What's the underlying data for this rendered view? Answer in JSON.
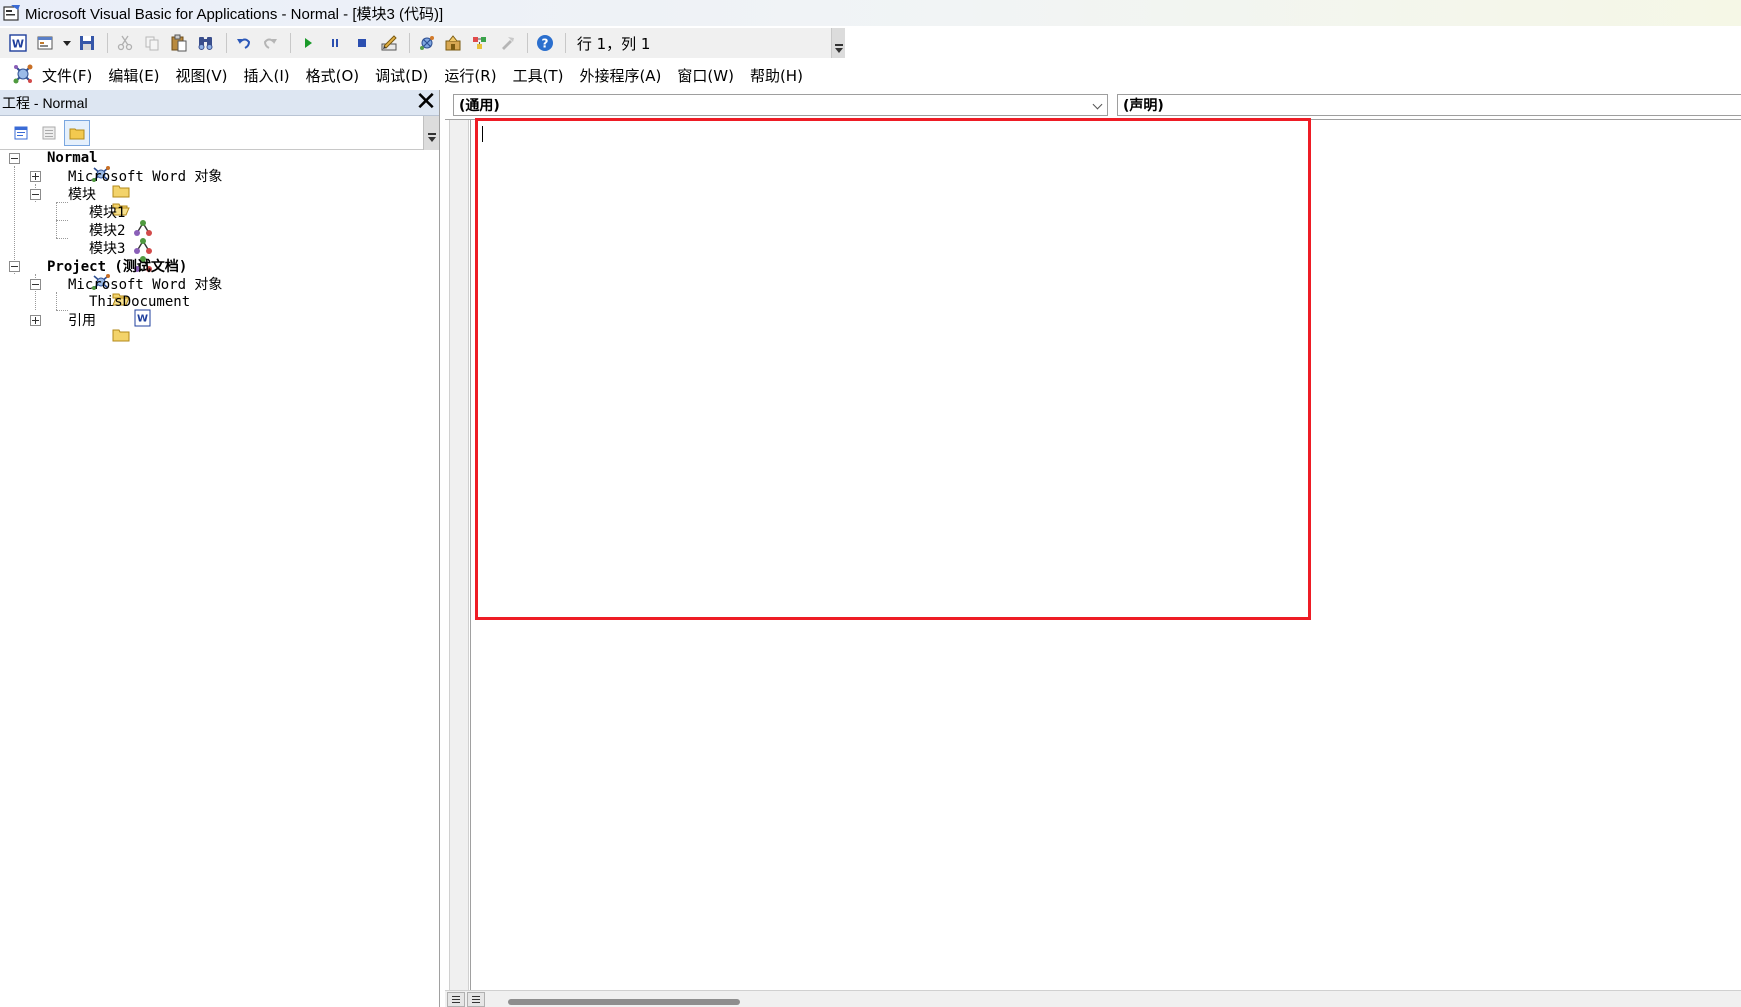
{
  "window": {
    "title": "Microsoft Visual Basic for Applications - Normal - [模块3 (代码)]"
  },
  "toolbar": {
    "buttons": [
      "word-icon",
      "insert-userform-icon",
      "save-icon",
      "cut-icon",
      "copy-icon",
      "paste-icon",
      "find-icon",
      "undo-icon",
      "redo-icon",
      "run-icon",
      "break-icon",
      "reset-icon",
      "design-mode-icon",
      "project-explorer-icon",
      "properties-window-icon",
      "object-browser-icon",
      "toolbox-icon",
      "help-icon"
    ],
    "position": "行 1，列 1"
  },
  "menu": {
    "items": [
      "文件(F)",
      "编辑(E)",
      "视图(V)",
      "插入(I)",
      "格式(O)",
      "调试(D)",
      "运行(R)",
      "工具(T)",
      "外接程序(A)",
      "窗口(W)",
      "帮助(H)"
    ]
  },
  "project_panel": {
    "title": "工程 - Normal",
    "close": "✕",
    "tree": [
      {
        "label": "Normal",
        "level": 0,
        "expander": "minus",
        "icon": "project-icon",
        "bold": true
      },
      {
        "label": "Microsoft Word 对象",
        "level": 1,
        "expander": "plus",
        "icon": "folder-closed-icon",
        "bold": false
      },
      {
        "label": "模块",
        "level": 1,
        "expander": "minus",
        "icon": "folder-open-icon",
        "bold": false
      },
      {
        "label": "模块1",
        "level": 2,
        "expander": "",
        "icon": "module-icon",
        "bold": false
      },
      {
        "label": "模块2",
        "level": 2,
        "expander": "",
        "icon": "module-icon",
        "bold": false
      },
      {
        "label": "模块3",
        "level": 2,
        "expander": "",
        "icon": "module-icon",
        "bold": false
      },
      {
        "label": "Project (测试文档)",
        "level": 0,
        "expander": "minus",
        "icon": "project-icon",
        "bold": true
      },
      {
        "label": "Microsoft Word 对象",
        "level": 1,
        "expander": "minus",
        "icon": "folder-open-icon",
        "bold": false
      },
      {
        "label": "ThisDocument",
        "level": 2,
        "expander": "",
        "icon": "word-document-icon",
        "bold": false
      },
      {
        "label": "引用",
        "level": 1,
        "expander": "plus",
        "icon": "folder-closed-icon",
        "bold": false
      }
    ]
  },
  "code_window": {
    "object_dropdown": "(通用)",
    "procedure_dropdown": "(声明)",
    "highlight_color": "#ee1c25"
  }
}
